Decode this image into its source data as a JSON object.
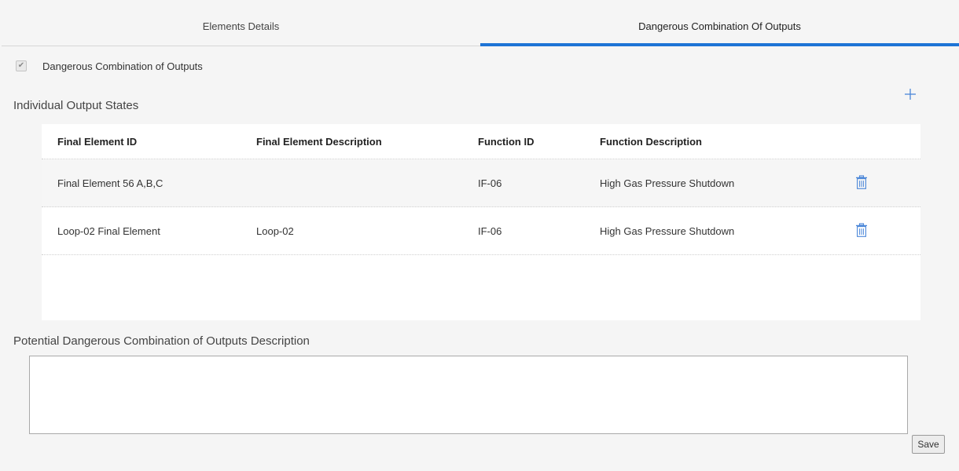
{
  "tabs": [
    {
      "label": "Elements Details",
      "active": false
    },
    {
      "label": "Dangerous Combination Of Outputs",
      "active": true
    }
  ],
  "dangerous_checkbox": {
    "label": "Dangerous Combination of Outputs",
    "checked": true,
    "check_glyph": "✔"
  },
  "outputs_section": {
    "title": "Individual Output States",
    "add_icon": "plus-icon"
  },
  "table": {
    "columns": [
      "Final Element ID",
      "Final Element Description",
      "Function ID",
      "Function Description"
    ],
    "rows": [
      {
        "final_element_id": "Final Element 56 A,B,C",
        "final_element_description": "",
        "function_id": "IF-06",
        "function_description": "High Gas Pressure Shutdown",
        "delete_icon": "trash-icon"
      },
      {
        "final_element_id": "Loop-02 Final Element",
        "final_element_description": "Loop-02",
        "function_id": "IF-06",
        "function_description": "High Gas Pressure Shutdown",
        "delete_icon": "trash-icon"
      }
    ]
  },
  "description_section": {
    "title": "Potential Dangerous Combination of Outputs Description",
    "value": ""
  },
  "save_label": "Save",
  "colors": {
    "accent": "#1e74d6",
    "icon_blue": "#4a86d8"
  }
}
